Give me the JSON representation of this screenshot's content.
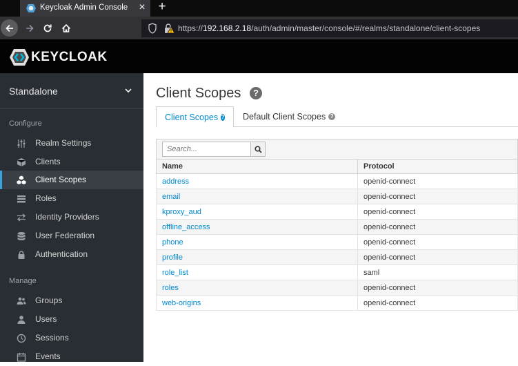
{
  "browser": {
    "tab_title": "Keycloak Admin Console",
    "url_prefix": "https://",
    "url_host": "192.168.2.18",
    "url_path": "/auth/admin/master/console/#/realms/standalone/client-scopes"
  },
  "header": {
    "logo_text": "KEYCLOAK"
  },
  "sidebar": {
    "realm": "Standalone",
    "configure_label": "Configure",
    "manage_label": "Manage",
    "configure_items": [
      {
        "label": "Realm Settings",
        "icon": "sliders-icon"
      },
      {
        "label": "Clients",
        "icon": "cube-icon"
      },
      {
        "label": "Client Scopes",
        "icon": "cubes-icon",
        "active": true
      },
      {
        "label": "Roles",
        "icon": "tasks-icon"
      },
      {
        "label": "Identity Providers",
        "icon": "exchange-icon"
      },
      {
        "label": "User Federation",
        "icon": "database-icon"
      },
      {
        "label": "Authentication",
        "icon": "lock-icon"
      }
    ],
    "manage_items": [
      {
        "label": "Groups",
        "icon": "users-icon"
      },
      {
        "label": "Users",
        "icon": "user-icon"
      },
      {
        "label": "Sessions",
        "icon": "clock-icon"
      },
      {
        "label": "Events",
        "icon": "calendar-icon"
      }
    ]
  },
  "main": {
    "title": "Client Scopes",
    "tabs": [
      {
        "label": "Client Scopes",
        "active": true
      },
      {
        "label": "Default Client Scopes",
        "active": false
      }
    ],
    "search_placeholder": "Search...",
    "table": {
      "headers": [
        "Name",
        "Protocol"
      ],
      "rows": [
        [
          "address",
          "openid-connect"
        ],
        [
          "email",
          "openid-connect"
        ],
        [
          "kproxy_aud",
          "openid-connect"
        ],
        [
          "offline_access",
          "openid-connect"
        ],
        [
          "phone",
          "openid-connect"
        ],
        [
          "profile",
          "openid-connect"
        ],
        [
          "role_list",
          "saml"
        ],
        [
          "roles",
          "openid-connect"
        ],
        [
          "web-origins",
          "openid-connect"
        ]
      ]
    }
  },
  "colors": {
    "accent": "#0088ce",
    "sidebar_bg": "#292e34",
    "active_bar": "#39a5dc"
  }
}
